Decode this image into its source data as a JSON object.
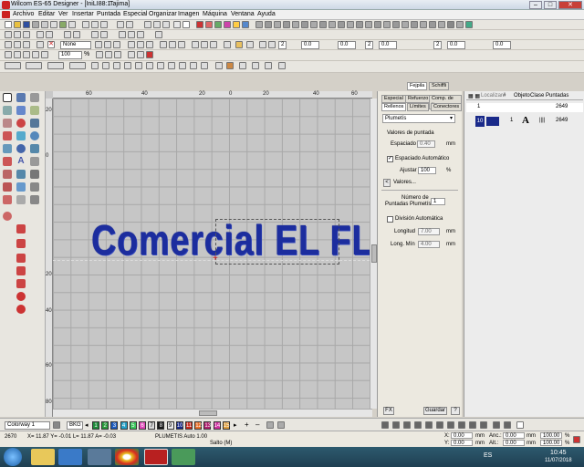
{
  "app": {
    "title": "Wilcom ES-65 Designer - [IniLI88:1",
    "title_tab": "Tajima]"
  },
  "menu": [
    "Archivo",
    "Editar",
    "Ver",
    "Insertar",
    "Puntada",
    "Especial",
    "Organizar",
    "Imagen",
    "Máquina",
    "Ventana",
    "Ayuda"
  ],
  "toolbar": {
    "fill_select": "None",
    "zoom": "100",
    "zoom_unit": "%",
    "numA": "2",
    "numB": "0.0",
    "numC": "0.0",
    "numD": "2",
    "numE": "0.0",
    "numF": "2",
    "numG": "0.0",
    "numH": "0.0"
  },
  "ruler": {
    "h": [
      "60",
      "40",
      "20",
      "0",
      "20",
      "40",
      "60"
    ],
    "v": [
      "20",
      "0",
      "20",
      "40",
      "60",
      "80"
    ]
  },
  "canvas": {
    "text": "Comercial EL FLACO"
  },
  "panel": {
    "top_tabs": [
      "Fejpila",
      "Schiffli"
    ],
    "tabs_row1": [
      "Especial",
      "Refuerzo",
      "Comp. de tire"
    ],
    "tabs_row2": [
      "Rellenos",
      "Límites",
      "Conectores"
    ],
    "fill_type": "Plumetís",
    "valores_title": "Valores de puntada",
    "espaciado_label": "Espaciado",
    "espaciado_val": "0.40",
    "mm": "mm",
    "auto_label": "Espaciado Automático",
    "ajustar_label": "Ajustar",
    "ajustar_val": "100",
    "pct": "%",
    "valores_btn": "Valores...",
    "numero_label": "Número de",
    "puntadas_label": "Puntadas Plumetís",
    "numero_val": "1",
    "division_label": "División Automática",
    "longitud_label": "Longitud",
    "longitud_val": "7.00",
    "longmin_label": "Long. Mín",
    "longmin_val": "4.00",
    "fx": "FX",
    "guardar": "Guardar",
    "help": "?"
  },
  "objlist": {
    "localizar": "Localizar",
    "headers": [
      "#",
      "Objeto",
      "Clase",
      "Puntadas"
    ],
    "rows": [
      {
        "num": "1",
        "puntadas": "2649"
      },
      {
        "num": "1",
        "clase": "A",
        "puntadas": "2649",
        "thumb": "10"
      }
    ]
  },
  "colorbar": {
    "colorway": "Colorway 1",
    "bkg": "BKG",
    "swatches": [
      {
        "n": "1",
        "c": "#1f8c3a"
      },
      {
        "n": "2",
        "c": "#2a9a3c"
      },
      {
        "n": "3",
        "c": "#1c5bbf"
      },
      {
        "n": "4",
        "c": "#26a0c8"
      },
      {
        "n": "5",
        "c": "#3ac45a"
      },
      {
        "n": "6",
        "c": "#e048b8"
      },
      {
        "n": "7",
        "c": "#d8d8d8"
      },
      {
        "n": "8",
        "c": "#1a1a1a"
      },
      {
        "n": "9",
        "c": "#e8e8e8"
      },
      {
        "n": "10",
        "c": "#1a2a8a"
      },
      {
        "n": "11",
        "c": "#c8281c"
      },
      {
        "n": "12",
        "c": "#e8702a"
      },
      {
        "n": "13",
        "c": "#b02070"
      },
      {
        "n": "14",
        "c": "#d030a0"
      },
      {
        "n": "15",
        "c": "#e0a040"
      }
    ]
  },
  "status": {
    "count": "2670",
    "coords": "X=  11.87 Y= -0.01 L=  11.87 A= -0.03",
    "mode": "PLUMETIS Auto  1.00",
    "salto": "Salto (M)",
    "x_label": "X:",
    "x_val": "0.00",
    "y_label": "Y:",
    "y_val": "0.00",
    "mm": "mm",
    "anc_label": "Anc.:",
    "anc_val": "0.00",
    "alt_label": "Alt.:",
    "alt_val": "0.00",
    "pct1": "100.00",
    "pct2": "100.00",
    "pct": "%"
  },
  "taskbar": {
    "lang": "ES",
    "time": "10:45",
    "date": "11/07/2018"
  }
}
